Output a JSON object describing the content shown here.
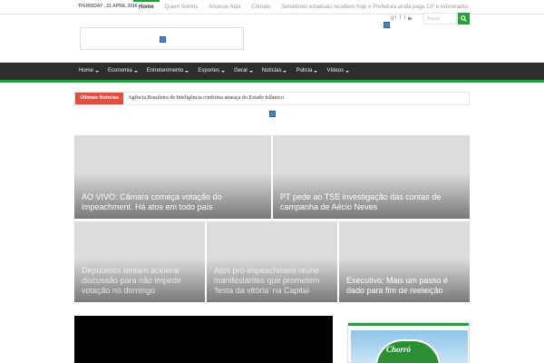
{
  "topbar": {
    "date": "Thursday , 21 April 2016",
    "links": [
      "Home",
      "Quem Somos",
      "Anuncie Aqui",
      "Contato",
      "Servidores estaduais recebem hoje e Prefeitura ainda paga 13º e exonerados"
    ]
  },
  "header": {
    "social_icons": [
      "google-plus-icon",
      "facebook-icon",
      "twitter-icon",
      "youtube-icon"
    ],
    "search_placeholder": "Busca"
  },
  "nav": {
    "items": [
      "Home",
      "Economia",
      "Entretenimento",
      "Esportes",
      "Geral",
      "Notícias",
      "Polícia",
      "Vídeos"
    ]
  },
  "breaking": {
    "label": "Últimas Notícias",
    "headline": "Agência Brasileira de Inteligência confirma ameaça do Estado Islâmico"
  },
  "slider": [
    {
      "caption": "AO VIVO: Câmara começa votação do impeachment. Há atos em todo país"
    },
    {
      "caption": "PT pede ao TSE investigação das contas de campanha de Aécio Neves"
    },
    {
      "caption": "Deputados tentam acelerar discussão para não impedir votação no domingo"
    },
    {
      "caption": "Atos pró-impeachment reúne manifestantes que prometem 'festa da vitória' na Capital"
    },
    {
      "caption": "Executivo: Mais um passo é dado para fim de reeleição"
    }
  ],
  "sidebar": {
    "logo_text": "Chorró"
  },
  "colors": {
    "accent": "#25a03a",
    "nav_bg": "#2d2d2d",
    "breaking_label": "#e74c3c"
  }
}
